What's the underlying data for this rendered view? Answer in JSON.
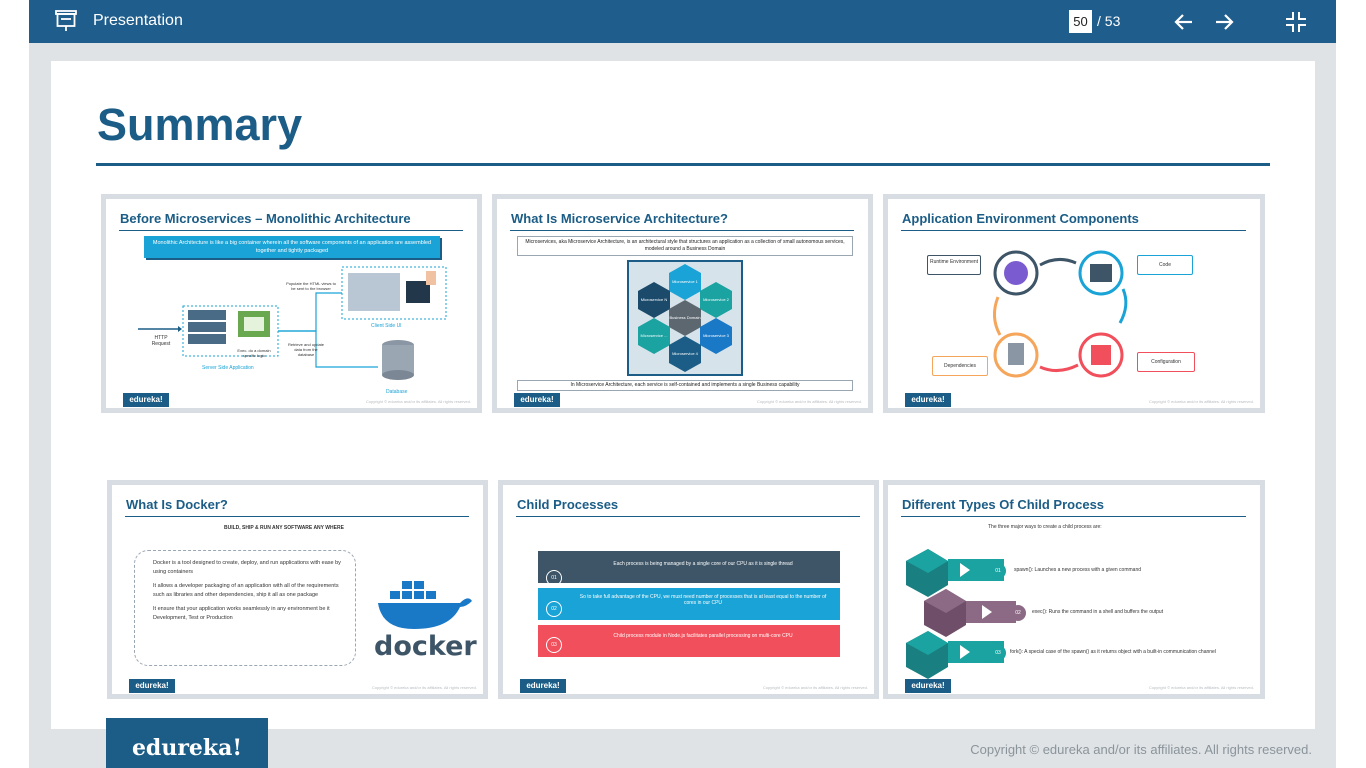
{
  "app": {
    "title": "Presentation",
    "current_page": "50",
    "total_pages": "/ 53",
    "icons": [
      "presentation-icon",
      "arrow-left-icon",
      "arrow-right-icon",
      "exit-fullscreen-icon"
    ]
  },
  "slide": {
    "title": "Summary",
    "thumbs": [
      {
        "title": "Before Microservices – Monolithic Architecture",
        "callout": "Monolithic Architecture is like a big container wherein all the software components of an application are assembled together and tightly packaged",
        "labels": [
          "HTTP Request",
          "Populate the HTML views to be sent to the browser",
          "Client Side UI",
          "Exec. do a domain specific logic",
          "Retrieve and update data from the database",
          "Server Side Application",
          "Database"
        ]
      },
      {
        "title": "What Is Microservice Architecture?",
        "intro": "Microservices, aka Microservice Architecture, is an architectural style that structures an application as a collection of small autonomous services, modeled around a Business Domain",
        "hexes": [
          "Microservice 1",
          "Microservice 2",
          "Microservice N",
          "Business Domain",
          "Microservice 3",
          "Microservice ...",
          "Microservice 4"
        ],
        "bottom": "In Microservice Architecture, each service is self-contained and implements a single Business capability"
      },
      {
        "title": "Application Environment Components",
        "boxes": [
          "Runtime Environment",
          "Code",
          "Dependencies",
          "Configuration"
        ]
      },
      {
        "title": "What Is Docker?",
        "quote": "BUILD, SHIP & RUN ANY SOFTWARE ANY WHERE",
        "bullets": [
          "Docker is a tool designed to create, deploy, and run applications with ease by using containers",
          "It allows a developer packaging of an application with all of the requirements such as libraries and other dependencies, ship it all as one package",
          "It ensure that your application works seamlessly in any environment be it Development, Test or Production"
        ],
        "logo_text": "docker"
      },
      {
        "title": "Child Processes",
        "steps": [
          {
            "num": "01",
            "text": "Each process is being managed by a single core of our CPU as it is single thread",
            "color": "#3d5567"
          },
          {
            "num": "02",
            "text": "So to take full advantage of the CPU, we must need number of processes that is at least equal to the number of cores in our CPU",
            "color": "#1aa3d6"
          },
          {
            "num": "03",
            "text": "Child process module in Node.js facilitates parallel processing on multi-core CPU",
            "color": "#f14f5b"
          }
        ]
      },
      {
        "title": "Different Types Of Child Process",
        "intro": "The three major ways to create a child process are:",
        "items": [
          {
            "num": "01",
            "text": "spawn(): Launches a new process with a given command"
          },
          {
            "num": "02",
            "text": "exec(): Runs the command in a shell and buffers the output"
          },
          {
            "num": "03",
            "text": "fork(): A special case of the spawn() as it returns object with a built-in communication channel"
          }
        ]
      }
    ],
    "thumb_logo": "edureka!",
    "thumb_copy": "Copyright © edureka and/or its affiliates. All rights reserved."
  },
  "footer": {
    "logo": "edureka!",
    "copyright": "Copyright © edureka and/or its affiliates. All rights reserved."
  },
  "colors": {
    "topbar": "#1f5d8c",
    "accent": "#1b5d86",
    "teal": "#1aa3a0",
    "red": "#f14f5b"
  }
}
